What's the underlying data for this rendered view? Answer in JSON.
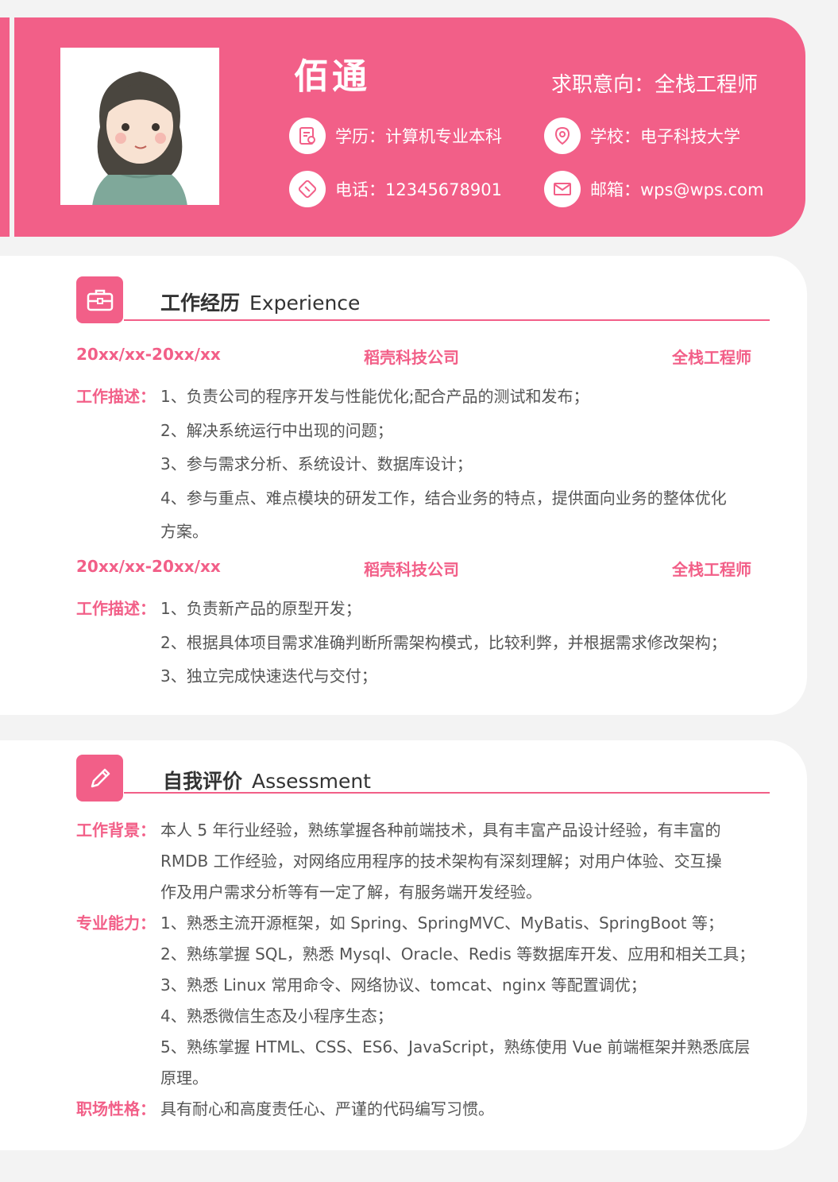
{
  "profile": {
    "name": "佰通",
    "objective": "求职意向：全栈工程师",
    "education": "学历：计算机专业本科",
    "school": "学校：电子科技大学",
    "phone": "电话：12345678901",
    "email": "邮箱：wps@wps.com"
  },
  "icons": {
    "photo": "avatar-illustration",
    "education": "certificate-icon",
    "school": "location-pin-icon",
    "phone": "phone-icon",
    "email": "envelope-icon",
    "experience": "briefcase-icon",
    "assessment": "pencil-icon"
  },
  "colors": {
    "accent": "#f25f88",
    "background": "#f3f3f3",
    "card": "#ffffff"
  },
  "experience": {
    "title_zh": "工作经历",
    "title_en": "Experience",
    "jobs": [
      {
        "date": "20xx/xx-20xx/xx",
        "company": "稻壳科技公司",
        "position": "全栈工程师",
        "label": "工作描述：",
        "lines": [
          "1、负责公司的程序开发与性能优化;配合产品的测试和发布；",
          "2、解决系统运行中出现的问题；",
          "3、参与需求分析、系统设计、数据库设计；",
          "4、参与重点、难点模块的研发工作，结合业务的特点，提供面向业务的整体优化",
          "方案。"
        ]
      },
      {
        "date": "20xx/xx-20xx/xx",
        "company": "稻壳科技公司",
        "position": "全栈工程师",
        "label": "工作描述：",
        "lines": [
          "1、负责新产品的原型开发；",
          "2、根据具体项目需求准确判断所需架构模式，比较利弊，并根据需求修改架构；",
          "3、独立完成快速迭代与交付；"
        ]
      }
    ]
  },
  "assessment": {
    "title_zh": "自我评价",
    "title_en": "Assessment",
    "blocks": [
      {
        "label": "工作背景：",
        "lines": [
          "本人 5 年行业经验，熟练掌握各种前端技术，具有丰富产品设计经验，有丰富的",
          "RMDB 工作经验，对网络应用程序的技术架构有深刻理解；对用户体验、交互操",
          "作及用户需求分析等有一定了解，有服务端开发经验。"
        ]
      },
      {
        "label": "专业能力：",
        "lines": [
          "1、熟悉主流开源框架，如 Spring、SpringMVC、MyBatis、SpringBoot 等；",
          "2、熟练掌握 SQL，熟悉 Mysql、Oracle、Redis 等数据库开发、应用和相关工具；",
          "3、熟悉 Linux 常用命令、网络协议、tomcat、nginx 等配置调优；",
          "4、熟悉微信生态及小程序生态；",
          "5、熟练掌握 HTML、CSS、ES6、JavaScript，熟练使用 Vue 前端框架并熟悉底层",
          "原理。"
        ]
      },
      {
        "label": "职场性格：",
        "lines": [
          "具有耐心和高度责任心、严谨的代码编写习惯。"
        ]
      }
    ]
  }
}
